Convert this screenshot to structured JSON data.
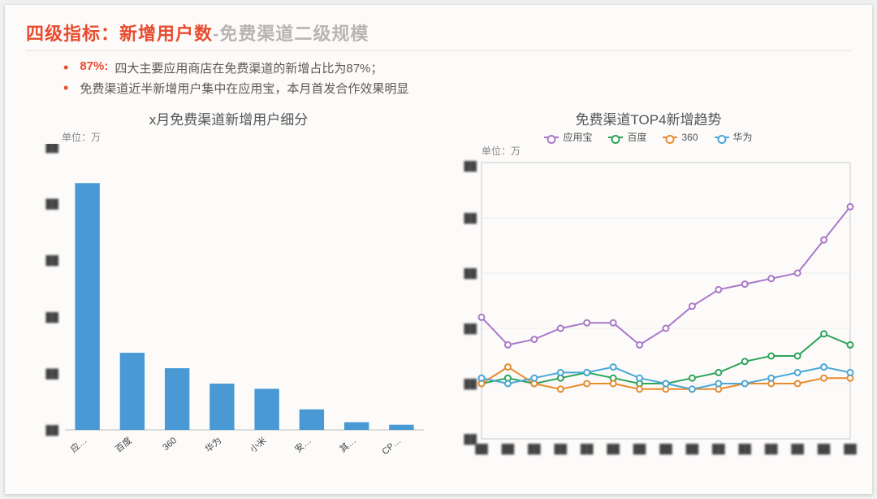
{
  "title": {
    "red": "四级指标：新增用户数",
    "gray": "-免费渠道二级规模"
  },
  "bullets": [
    {
      "highlight": "87%:",
      "text": "四大主要应用商店在免费渠道的新增占比为87%；"
    },
    {
      "highlight": "",
      "text": "免费渠道近半新增用户集中在应用宝，本月首发合作效果明显"
    }
  ],
  "chart_data": [
    {
      "type": "bar",
      "title": "x月免费渠道新增用户细分",
      "unit": "单位：万",
      "ylabel": "",
      "xlabel": "",
      "categories": [
        "应…",
        "百度",
        "360",
        "华为",
        "小米",
        "安…",
        "其…",
        "CP…"
      ],
      "values": [
        48,
        15,
        12,
        9,
        8,
        4,
        1.5,
        1
      ],
      "ylim": [
        0,
        55
      ],
      "note": "y-axis tick labels are obscured in the source image"
    },
    {
      "type": "line",
      "title": "免费渠道TOP4新增趋势",
      "unit": "单位：万",
      "ylabel": "",
      "xlabel": "",
      "x": [
        1,
        2,
        3,
        4,
        5,
        6,
        7,
        8,
        9,
        10,
        11,
        12,
        13,
        14,
        15
      ],
      "series": [
        {
          "name": "应用宝",
          "color": "#a978c8",
          "values": [
            22,
            17,
            18,
            20,
            21,
            21,
            17,
            20,
            24,
            27,
            28,
            29,
            30,
            36,
            42
          ]
        },
        {
          "name": "百度",
          "color": "#2fa35a",
          "values": [
            10,
            11,
            10,
            11,
            12,
            11,
            10,
            10,
            11,
            12,
            14,
            15,
            15,
            19,
            17
          ]
        },
        {
          "name": "360",
          "color": "#e88b2f",
          "values": [
            10,
            13,
            10,
            9,
            10,
            10,
            9,
            9,
            9,
            9,
            10,
            10,
            10,
            11,
            11
          ]
        },
        {
          "name": "华为",
          "color": "#4aa7d6",
          "values": [
            11,
            10,
            11,
            12,
            12,
            13,
            11,
            10,
            9,
            10,
            10,
            11,
            12,
            13,
            12
          ]
        }
      ],
      "ylim": [
        0,
        50
      ],
      "note": "axis tick labels are obscured in the source image"
    }
  ]
}
